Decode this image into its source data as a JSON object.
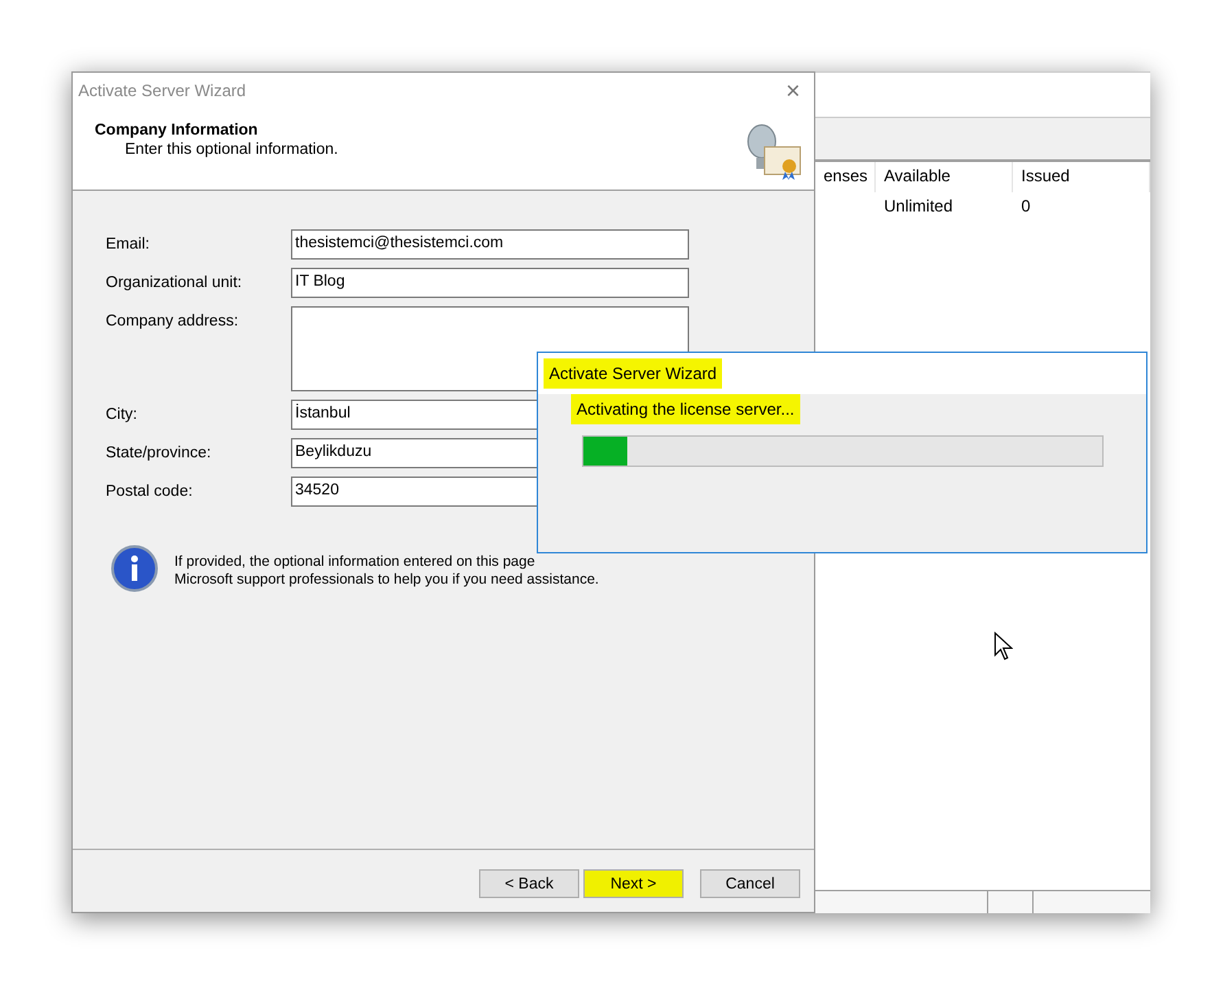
{
  "wizard": {
    "title": "Activate Server Wizard",
    "close": "×",
    "header": {
      "title": "Company Information",
      "subtitle": "Enter this optional information."
    },
    "fields": [
      {
        "label": "Email:",
        "value": "thesistemci@thesistemci.com",
        "kind": "line"
      },
      {
        "label": "Organizational unit:",
        "value": "IT Blog",
        "kind": "line"
      },
      {
        "label": "Company address:",
        "kind": "area"
      },
      {
        "label": "City:",
        "value": "İstanbul",
        "kind": "line"
      },
      {
        "label": "State/province:",
        "value": "Beylikduzu",
        "kind": "line"
      },
      {
        "label": "Postal code:",
        "value": "34520",
        "kind": "line"
      }
    ],
    "info": [
      "If provided, the optional information entered on this page",
      "Microsoft support professionals to help you if you need assistance."
    ],
    "buttons": [
      {
        "label": "< Back",
        "highlighted": false
      },
      {
        "label": "Next >",
        "highlighted": true
      },
      {
        "label": "Cancel",
        "highlighted": false
      }
    ]
  },
  "background_window": {
    "columns": [
      "enses",
      "Available",
      "Issued"
    ],
    "rows": [
      [
        "",
        "Unlimited",
        "0"
      ]
    ]
  },
  "progress_dialog": {
    "title": "Activate Server Wizard",
    "title_highlighted": true,
    "status": "Activating the license server...",
    "status_highlighted": true,
    "level": 0.085
  }
}
